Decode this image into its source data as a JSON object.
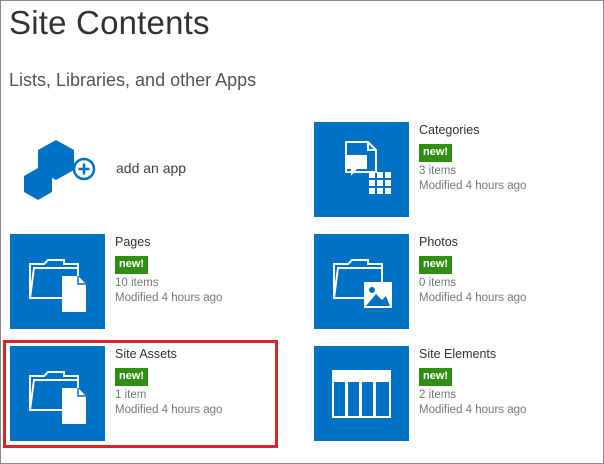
{
  "page": {
    "title": "Site Contents",
    "section_heading": "Lists, Libraries, and other Apps"
  },
  "add_app": {
    "label": "add an app"
  },
  "colors": {
    "tile": "#0072c6",
    "badge": "#2f8f12",
    "highlight": "#d6262c"
  },
  "apps": [
    {
      "id": "categories",
      "title": "Categories",
      "badge": "new!",
      "items": "3 items",
      "modified": "Modified 4 hours ago",
      "icon": "list-grid-icon"
    },
    {
      "id": "pages",
      "title": "Pages",
      "badge": "new!",
      "items": "10 items",
      "modified": "Modified 4 hours ago",
      "icon": "library-document-icon"
    },
    {
      "id": "photos",
      "title": "Photos",
      "badge": "new!",
      "items": "0 items",
      "modified": "Modified 4 hours ago",
      "icon": "picture-library-icon"
    },
    {
      "id": "site-assets",
      "title": "Site Assets",
      "badge": "new!",
      "items": "1 item",
      "modified": "Modified 4 hours ago",
      "icon": "library-document-icon"
    },
    {
      "id": "site-elements",
      "title": "Site Elements",
      "badge": "new!",
      "items": "2 items",
      "modified": "Modified 4 hours ago",
      "icon": "table-list-icon"
    }
  ]
}
